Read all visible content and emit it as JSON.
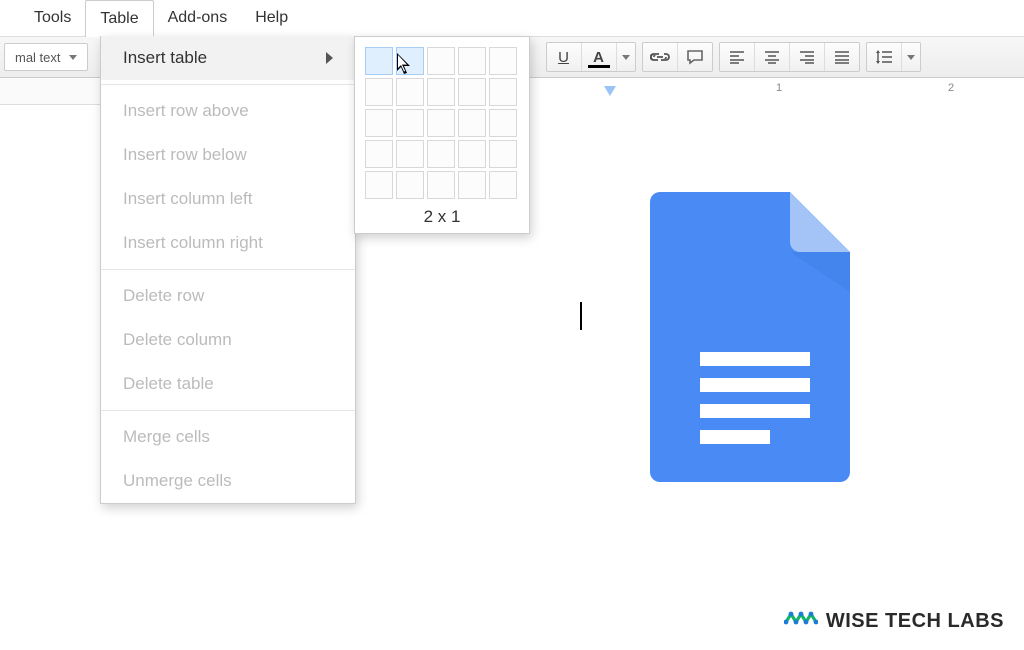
{
  "menubar": {
    "items": [
      "Tools",
      "Table",
      "Add-ons",
      "Help"
    ],
    "active_index": 1
  },
  "toolbar": {
    "style_dropdown": "mal text",
    "underline": "U",
    "text_color": "A"
  },
  "ruler": {
    "marks": [
      "1",
      "2"
    ]
  },
  "table_menu": {
    "insert_table": "Insert table",
    "groups": [
      [
        "Insert row above",
        "Insert row below",
        "Insert column left",
        "Insert column right"
      ],
      [
        "Delete row",
        "Delete column",
        "Delete table"
      ],
      [
        "Merge cells",
        "Unmerge cells"
      ]
    ]
  },
  "submenu": {
    "dimension": "2 x 1",
    "selected_cols": 2,
    "selected_rows": 1
  },
  "watermark": {
    "text": "WISE TECH LABS"
  }
}
